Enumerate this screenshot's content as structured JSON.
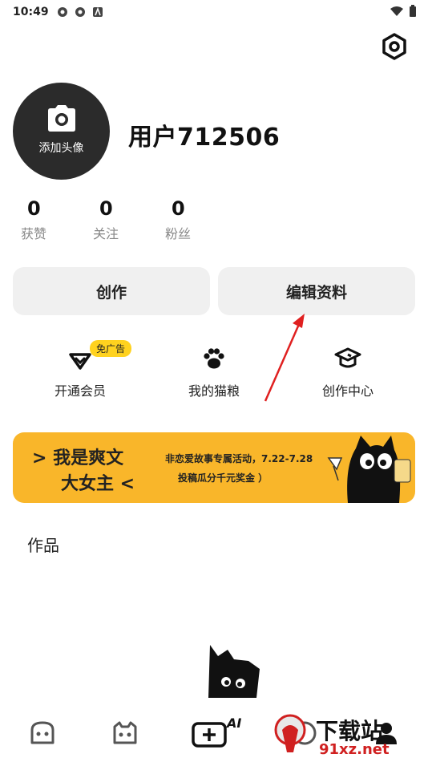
{
  "status_bar": {
    "time": "10:49"
  },
  "profile": {
    "avatar_label": "添加头像",
    "username": "用户712506"
  },
  "stats": [
    {
      "value": "0",
      "label": "获赞"
    },
    {
      "value": "0",
      "label": "关注"
    },
    {
      "value": "0",
      "label": "粉丝"
    }
  ],
  "actions": {
    "create": "创作",
    "edit_profile": "编辑资料"
  },
  "quick_links": [
    {
      "label": "开通会员",
      "badge": "免广告",
      "icon": "vip-icon"
    },
    {
      "label": "我的猫粮",
      "icon": "paw-icon"
    },
    {
      "label": "创作中心",
      "icon": "graduation-cap-icon"
    }
  ],
  "banner": {
    "title_line1": "> 我是爽文",
    "title_line2": "大女主 <",
    "subtitle_line1": "非恋爱故事专属活动，7.22-7.28",
    "subtitle_line2": "投稿瓜分千元奖金 ）"
  },
  "works": {
    "title": "作品"
  },
  "tabbar": {
    "ai_label": "AI"
  },
  "watermark": {
    "text1": "下载站",
    "text2": "91xz.net"
  },
  "colors": {
    "accent": "#ffd21f",
    "banner_bg": "#f9b62a",
    "arrow": "#e02020"
  }
}
